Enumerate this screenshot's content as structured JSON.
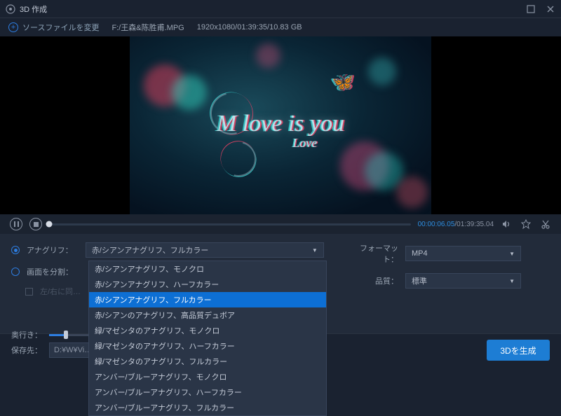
{
  "title": "3D 作成",
  "topbar": {
    "source_label": "ソースファイルを変更",
    "filepath": "F:/王森&陈胜甫.MPG",
    "metadata": "1920x1080/01:39:35/10.83 GB"
  },
  "preview": {
    "script_main": "M love is you",
    "script_sub": "Love"
  },
  "playback": {
    "current": "00:00:06.05",
    "sep": "/",
    "duration": "01:39:35.04"
  },
  "settings": {
    "anaglyph_label": "アナグリフ：",
    "anaglyph_value": "赤/シアンアナグリフ、フルカラー",
    "split_label": "画面を分割：",
    "lr_same_label": "左/右に同…",
    "depth_label": "奥行き：",
    "format_label": "フォーマット：",
    "format_value": "MP4",
    "quality_label": "品質：",
    "quality_value": "標準"
  },
  "dropdown_items": [
    "赤/シアンアナグリフ、モノクロ",
    "赤/シアンアナグリフ、ハーフカラー",
    "赤/シアンアナグリフ、フルカラー",
    "赤/シアンのアナグリフ、高品質デュボア",
    "緑/マゼンタのアナグリフ、モノクロ",
    "緑/マゼンタのアナグリフ、ハーフカラー",
    "緑/マゼンタのアナグリフ、フルカラー",
    "アンバー/ブルーアナグリフ、モノクロ",
    "アンバー/ブルーアナグリフ、ハーフカラー",
    "アンバー/ブルーアナグリフ、フルカラー"
  ],
  "dropdown_selected_index": 2,
  "bottom": {
    "save_label": "保存先：",
    "save_path": "D:¥W¥Vi…",
    "generate_label": "3Dを生成"
  }
}
